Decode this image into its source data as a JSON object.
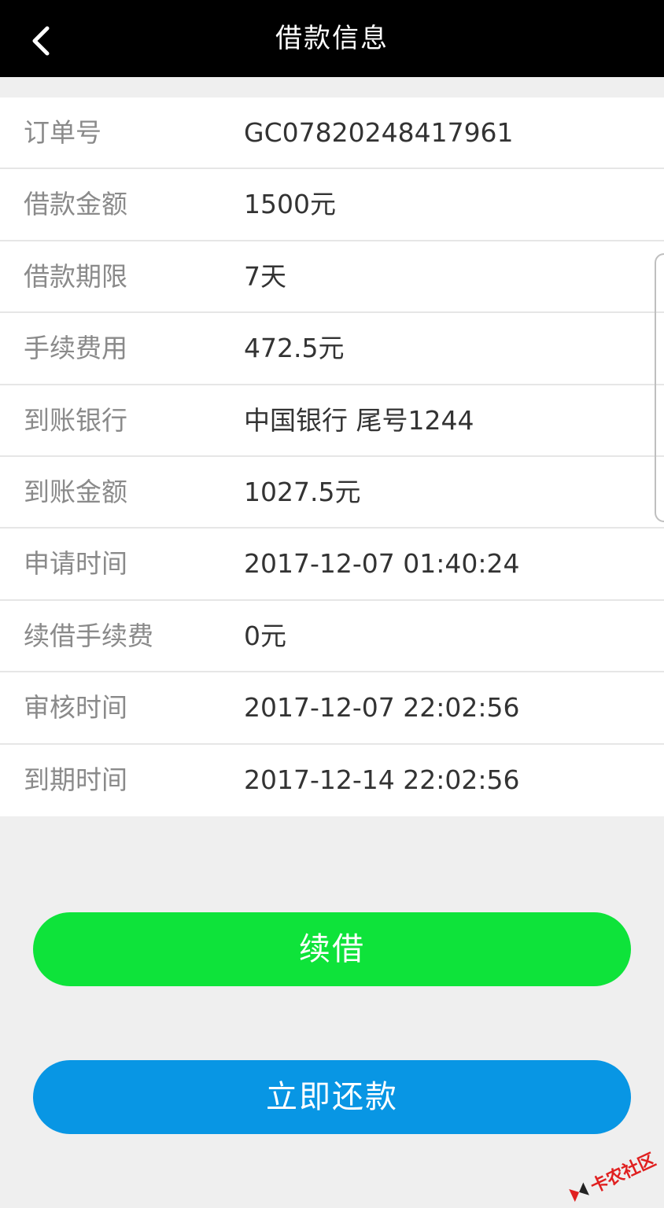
{
  "header": {
    "title": "借款信息",
    "back_icon": "chevron-left-icon"
  },
  "info": [
    {
      "label": "订单号",
      "value": "GC07820248417961"
    },
    {
      "label": "借款金额",
      "value": "1500元"
    },
    {
      "label": "借款期限",
      "value": "7天"
    },
    {
      "label": "手续费用",
      "value": "472.5元"
    },
    {
      "label": "到账银行",
      "value": "中国银行 尾号1244"
    },
    {
      "label": "到账金额",
      "value": "1027.5元"
    },
    {
      "label": "申请时间",
      "value": "2017-12-07 01:40:24"
    },
    {
      "label": "续借手续费",
      "value": "0元"
    },
    {
      "label": "审核时间",
      "value": "2017-12-07 22:02:56"
    },
    {
      "label": "到期时间",
      "value": "2017-12-14 22:02:56"
    }
  ],
  "actions": {
    "renew_label": "续借",
    "repay_label": "立即还款"
  },
  "watermark": {
    "text": "卡农社区"
  },
  "colors": {
    "header_bg": "#000000",
    "renew_btn": "#0ee33a",
    "repay_btn": "#0896e4",
    "watermark": "#e02020"
  }
}
